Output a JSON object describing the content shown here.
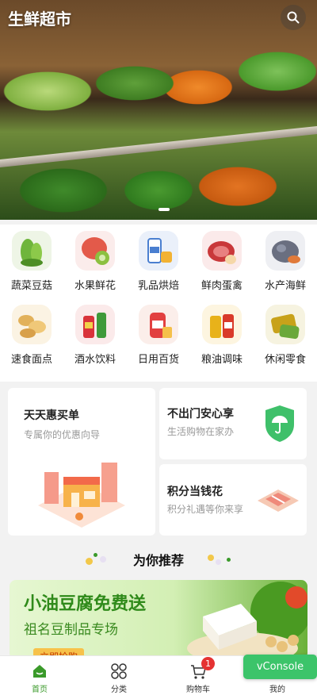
{
  "header": {
    "title": "生鲜超市",
    "search_icon": "search-icon"
  },
  "categories": [
    {
      "label": "蔬菜豆菇",
      "icon": "vegetable-icon",
      "color": "#6fb53c"
    },
    {
      "label": "水果鲜花",
      "icon": "fruit-icon",
      "color": "#e35a4a"
    },
    {
      "label": "乳品烘焙",
      "icon": "dairy-icon",
      "color": "#4a7fd0"
    },
    {
      "label": "鲜肉蛋禽",
      "icon": "meat-icon",
      "color": "#c9383a"
    },
    {
      "label": "水产海鲜",
      "icon": "seafood-icon",
      "color": "#6a6f80"
    },
    {
      "label": "速食面点",
      "icon": "dumpling-icon",
      "color": "#e2b15a"
    },
    {
      "label": "酒水饮料",
      "icon": "drinks-icon",
      "color": "#d9333a"
    },
    {
      "label": "日用百货",
      "icon": "household-icon",
      "color": "#e24040"
    },
    {
      "label": "粮油调味",
      "icon": "oil-icon",
      "color": "#e8b21a"
    },
    {
      "label": "休闲零食",
      "icon": "snack-icon",
      "color": "#c8a21a"
    }
  ],
  "promos": {
    "big": {
      "title": "天天惠买单",
      "subtitle": "专属你的优惠向导"
    },
    "small1": {
      "title": "不出门安心享",
      "subtitle": "生活购物在家办"
    },
    "small2": {
      "title": "积分当钱花",
      "subtitle": "积分礼遇等你来享"
    }
  },
  "section": {
    "title": "为你推荐"
  },
  "banner": {
    "headline": "小油豆腐免费送",
    "subline": "祖名豆制品专场",
    "cta": "立即抢购"
  },
  "tabbar": {
    "items": [
      {
        "label": "首页",
        "icon": "home-icon"
      },
      {
        "label": "分类",
        "icon": "category-icon"
      },
      {
        "label": "购物车",
        "icon": "cart-icon"
      },
      {
        "label": "我的",
        "icon": "user-icon"
      }
    ],
    "cart_badge": "1",
    "active_color": "#3a9a2a"
  },
  "vconsole": {
    "label": "vConsole"
  }
}
